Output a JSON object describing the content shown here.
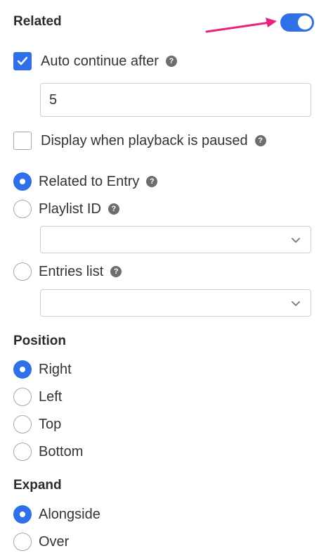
{
  "related": {
    "title": "Related",
    "enabled": true,
    "auto_continue": {
      "label": "Auto continue after",
      "checked": true,
      "help_icon": "question-circle-icon",
      "value": "5"
    },
    "display_paused": {
      "label": "Display when playback is paused",
      "checked": false,
      "help_icon": "question-circle-icon"
    },
    "source_options": [
      {
        "label": "Related to Entry",
        "selected": true
      },
      {
        "label": "Playlist ID",
        "selected": false,
        "select_value": ""
      },
      {
        "label": "Entries list",
        "selected": false,
        "select_value": ""
      }
    ]
  },
  "position": {
    "title": "Position",
    "options": [
      {
        "label": "Right",
        "selected": true
      },
      {
        "label": "Left",
        "selected": false
      },
      {
        "label": "Top",
        "selected": false
      },
      {
        "label": "Bottom",
        "selected": false
      }
    ]
  },
  "expand": {
    "title": "Expand",
    "options": [
      {
        "label": "Alongside",
        "selected": true
      },
      {
        "label": "Over",
        "selected": false
      }
    ]
  },
  "help_glyph": "?",
  "colors": {
    "accent": "#2f6fe8",
    "annotation_arrow": "#e8247a",
    "help_icon": "#6d6d6d"
  }
}
